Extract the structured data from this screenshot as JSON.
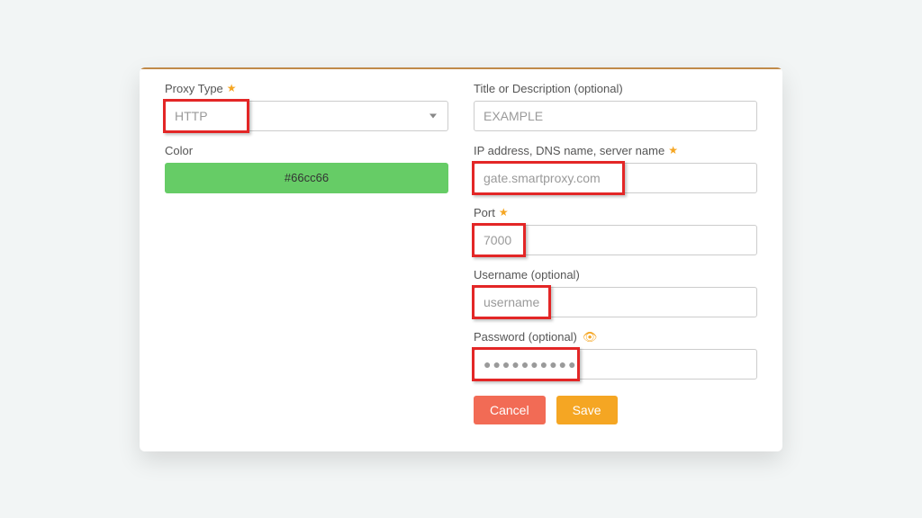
{
  "left": {
    "proxy_type_label": "Proxy Type",
    "proxy_type_value": "HTTP",
    "color_label": "Color",
    "color_value": "#66cc66"
  },
  "right": {
    "title_label": "Title or Description (optional)",
    "title_value": "EXAMPLE",
    "ip_label": "IP address, DNS name, server name",
    "ip_value": "gate.smartproxy.com",
    "port_label": "Port",
    "port_value": "7000",
    "username_label": "Username (optional)",
    "username_value": "username",
    "password_label": "Password (optional)",
    "password_masked": "●●●●●●●●●●"
  },
  "buttons": {
    "cancel": "Cancel",
    "save": "Save"
  },
  "colors": {
    "accent_orange": "#f5a623",
    "swatch_green": "#66cc66",
    "highlight_red": "#e32626",
    "cancel_red": "#f26b55"
  }
}
